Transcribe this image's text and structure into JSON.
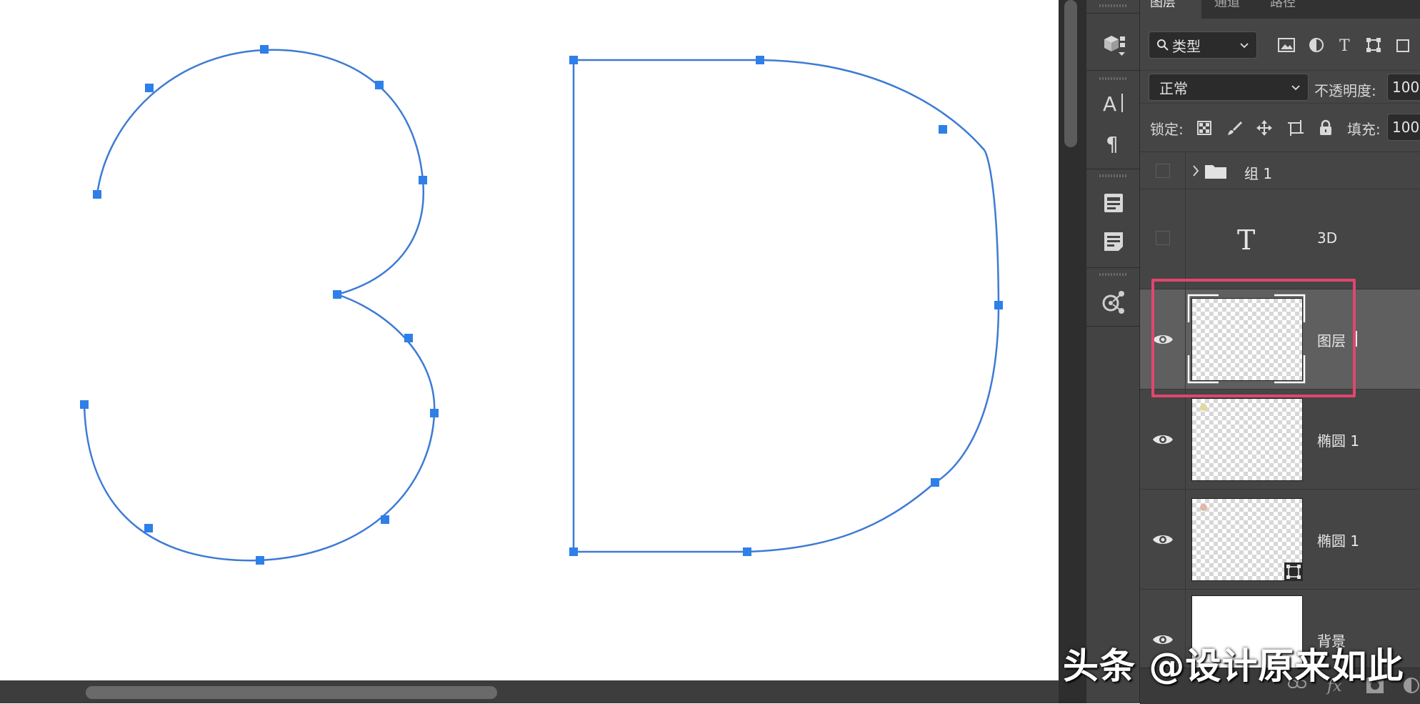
{
  "colors": {
    "path_stroke": "#3d7bd4",
    "anchor_fill": "#2f7fe8",
    "highlight": "#e0466f",
    "panel_bg": "#454545",
    "selected_row": "#5f5f5f"
  },
  "canvas": {
    "paths": [
      "3",
      "D"
    ]
  },
  "panel": {
    "tabs": [
      {
        "label": "图层",
        "active": true
      },
      {
        "label": "通道",
        "active": false
      },
      {
        "label": "路径",
        "active": false
      }
    ],
    "filter": {
      "kind_label": "类型",
      "icons": [
        "image-filter-icon",
        "adjustment-filter-icon",
        "type-filter-icon",
        "shape-filter-icon",
        "smart-object-filter-icon"
      ]
    },
    "blend_mode": "正常",
    "opacity_label": "不透明度:",
    "opacity_value": "100",
    "lock_label": "锁定:",
    "fill_label": "填充:",
    "fill_value": "100",
    "layers": [
      {
        "name": "组 1",
        "type": "group",
        "visible": false
      },
      {
        "name": "3D",
        "type": "text",
        "visible": false
      },
      {
        "name": "图层",
        "type": "pixel",
        "visible": true,
        "selected": true
      },
      {
        "name": "椭圆 1",
        "type": "pixel",
        "visible": true
      },
      {
        "name": "椭圆 1",
        "type": "shape",
        "visible": true
      },
      {
        "name": "背景",
        "type": "background",
        "visible": true
      }
    ],
    "bottom_icons": [
      "link-icon",
      "fx-icon",
      "mask-icon",
      "adjustment-icon"
    ]
  },
  "watermark": "头条 @设计原来如此"
}
